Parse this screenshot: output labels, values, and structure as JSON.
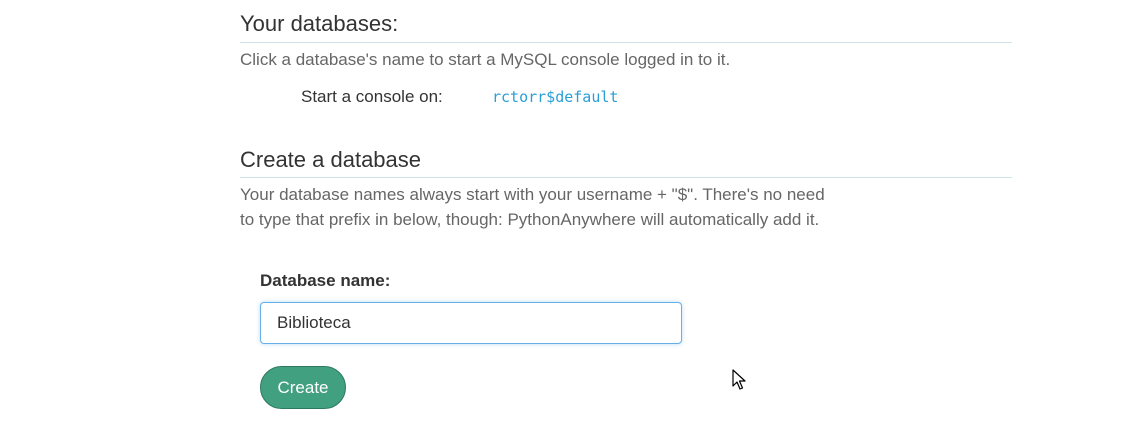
{
  "databases": {
    "heading": "Your databases:",
    "description": "Click a database's name to start a MySQL console logged in to it.",
    "console_label": "Start a console on:",
    "console_link": "rctorr$default"
  },
  "create": {
    "heading": "Create a database",
    "description": "Your database names always start with your username + \"$\". There's no need to type that prefix in below, though: PythonAnywhere will automatically add it.",
    "field_label": "Database name:",
    "field_value": "Biblioteca",
    "button_label": "Create"
  },
  "colors": {
    "link": "#2a9fd6",
    "button": "#41a07f",
    "rule": "#cfe3ea",
    "input_focus": "#66afe9"
  },
  "icons": {
    "cursor": "mouse-pointer-icon"
  }
}
